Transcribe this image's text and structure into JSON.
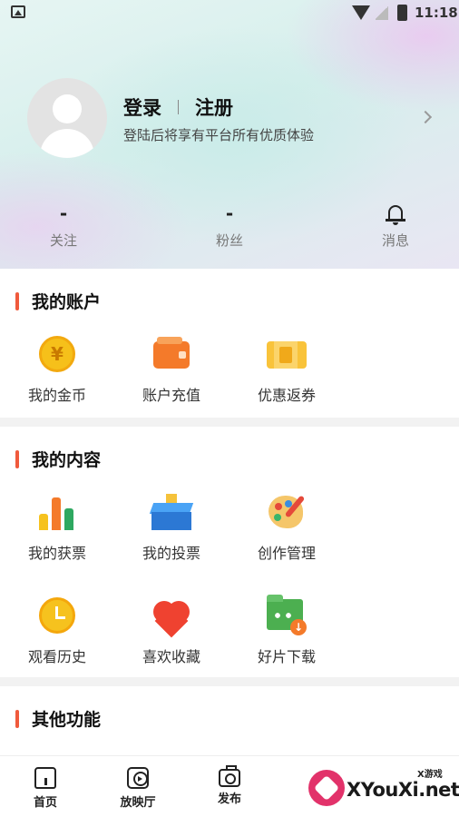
{
  "status_bar": {
    "time": "11:18"
  },
  "profile": {
    "login": "登录",
    "register": "注册",
    "subtitle": "登陆后将享有平台所有优质体验"
  },
  "stats": [
    {
      "value": "-",
      "label": "关注"
    },
    {
      "value": "-",
      "label": "粉丝"
    },
    {
      "icon": "bell-icon",
      "label": "消息"
    }
  ],
  "account": {
    "title": "我的账户",
    "items": [
      {
        "label": "我的金币",
        "icon": "coin-icon",
        "glyph": "¥"
      },
      {
        "label": "账户充值",
        "icon": "wallet-icon"
      },
      {
        "label": "优惠返券",
        "icon": "coupon-icon"
      }
    ]
  },
  "content": {
    "title": "我的内容",
    "items": [
      {
        "label": "我的获票",
        "icon": "bar-chart-icon"
      },
      {
        "label": "我的投票",
        "icon": "ballot-box-icon"
      },
      {
        "label": "创作管理",
        "icon": "palette-icon"
      },
      {
        "label": "观看历史",
        "icon": "clock-icon"
      },
      {
        "label": "喜欢收藏",
        "icon": "heart-icon"
      },
      {
        "label": "好片下载",
        "icon": "download-folder-icon"
      }
    ]
  },
  "other": {
    "title": "其他功能"
  },
  "bottom_nav": [
    {
      "label": "首页",
      "icon": "home-icon"
    },
    {
      "label": "放映厅",
      "icon": "play-icon"
    },
    {
      "label": "发布",
      "icon": "camera-icon"
    }
  ],
  "watermark": {
    "text": "XYouXi.net",
    "small": "X游戏"
  },
  "colors": {
    "accent": "#f05a3c",
    "background": "#f2f2f2"
  }
}
